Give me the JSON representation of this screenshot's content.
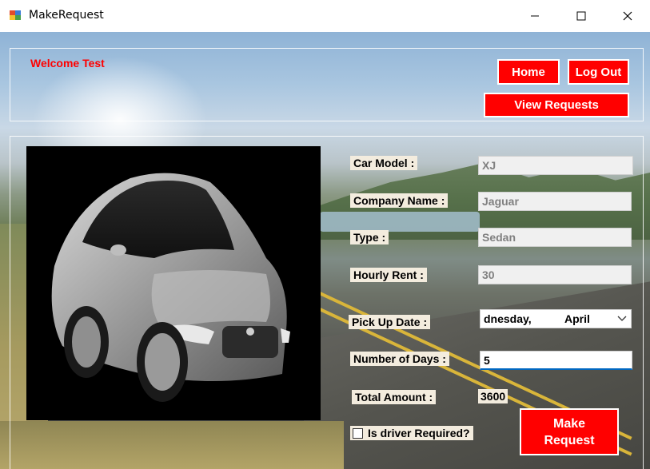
{
  "window": {
    "title": "MakeRequest",
    "icon": "windows-form-icon"
  },
  "header": {
    "welcome": "Welcome Test",
    "home_label": "Home",
    "logout_label": "Log Out",
    "view_requests_label": "View Requests"
  },
  "form": {
    "car_model_label": "Car Model :",
    "car_model_value": "XJ",
    "company_label": "Company Name :",
    "company_value": "Jaguar",
    "type_label": "Type :",
    "type_value": "Sedan",
    "hourly_rent_label": "Hourly Rent :",
    "hourly_rent_value": "30",
    "pickup_label": "Pick Up Date :",
    "pickup_value_part1": "dnesday,",
    "pickup_value_part2": "April",
    "days_label": "Number of Days :",
    "days_value": "5",
    "total_label": "Total Amount :",
    "total_value": "3600",
    "driver_label": "Is driver Required?",
    "driver_checked": false,
    "make_request_line1": "Make",
    "make_request_line2": "Request"
  },
  "colors": {
    "accent_red": "#ff0000",
    "welcome_red": "#ff0000",
    "label_bg": "#f3ecde",
    "focus_blue": "#0067c0"
  },
  "image": {
    "subject": "silver Jaguar XJ sedan on black background"
  }
}
